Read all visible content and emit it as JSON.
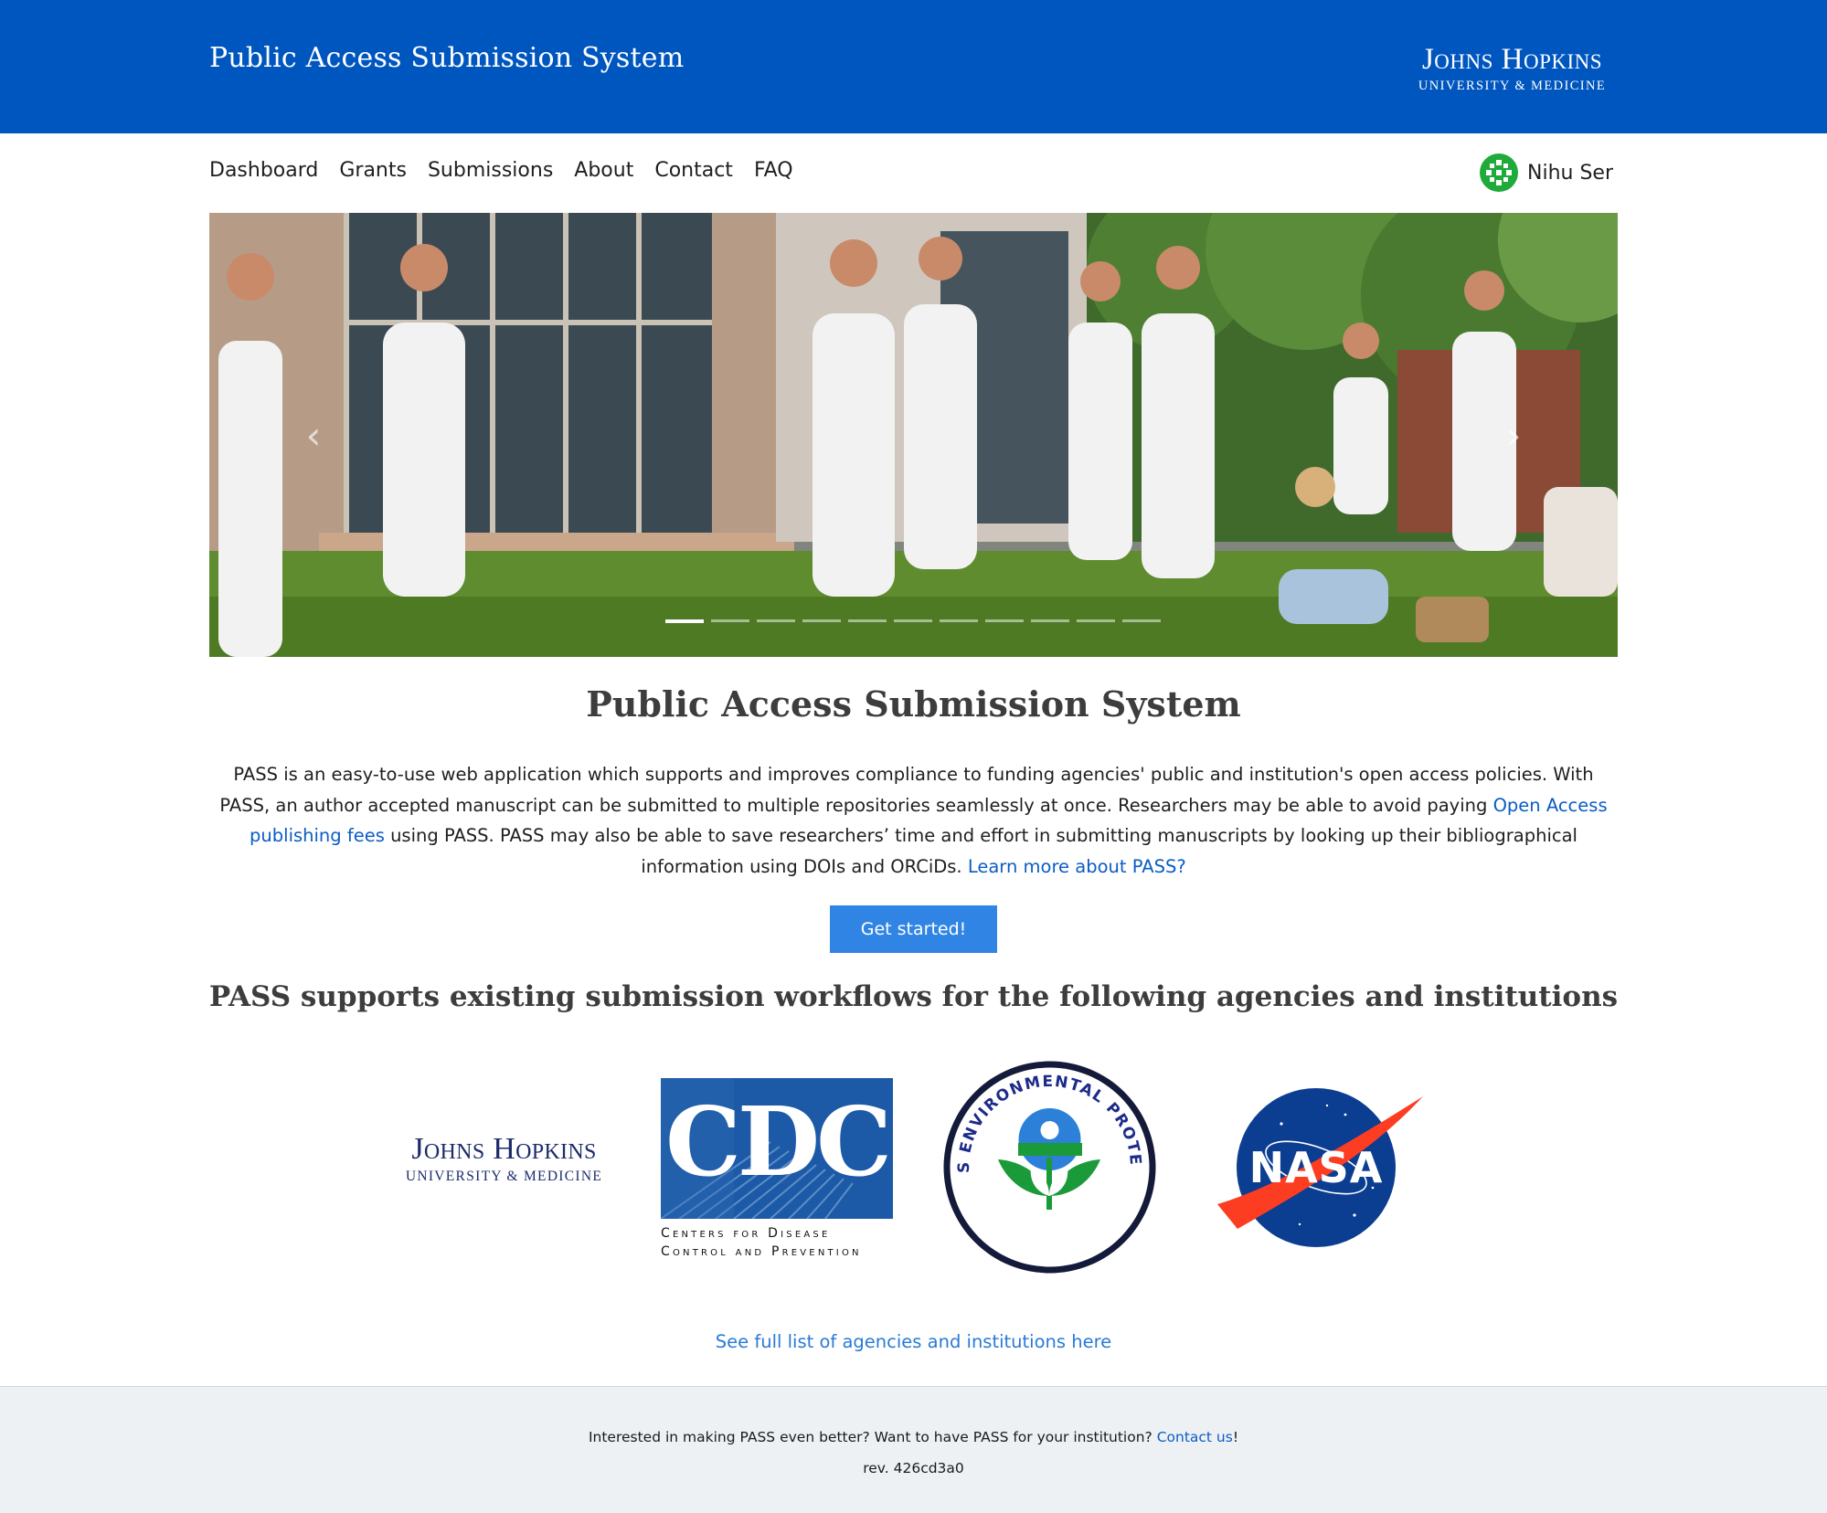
{
  "header": {
    "title": "Public Access Submission System",
    "logo": {
      "name": "Johns Hopkins",
      "subtitle": "UNIVERSITY & MEDICINE"
    }
  },
  "nav": {
    "items": [
      {
        "label": "Dashboard"
      },
      {
        "label": "Grants"
      },
      {
        "label": "Submissions"
      },
      {
        "label": "About"
      },
      {
        "label": "Contact"
      },
      {
        "label": "FAQ"
      }
    ],
    "user": {
      "name": "Nihu Ser",
      "avatar_icon": "user-avatar-icon"
    }
  },
  "carousel": {
    "image_icon": "carousel-photo",
    "prev_icon": "chevron-left-icon",
    "next_icon": "chevron-right-icon",
    "prev_glyph": "‹",
    "next_glyph": "›",
    "slide_count": 11,
    "active_index": 0
  },
  "intro": {
    "title": "Public Access Submission System",
    "text_1": "PASS is an easy-to-use web application which supports and improves compliance to funding agencies' public and institution's open access policies. With PASS, an author accepted manuscript can be submitted to multiple repositories seamlessly at once. Researchers may be able to avoid paying ",
    "link_fees": "Open Access publishing fees",
    "text_2": " using PASS. PASS may also be able to save researchers’ time and effort in submitting manuscripts by looking up their bibliographical information using DOIs and ORCiDs. ",
    "link_learn": "Learn more about PASS?",
    "cta": "Get started!"
  },
  "agencies": {
    "title": "PASS supports existing submission workflows for the following agencies and institutions",
    "jh": {
      "name": "Johns Hopkins",
      "subtitle": "UNIVERSITY & MEDICINE"
    },
    "cdc": {
      "letters": "CDC",
      "caption_1": "Centers for Disease",
      "caption_2": "Control and Prevention"
    },
    "epa": {
      "ring_text": "UNITED STATES ENVIRONMENTAL PROTECTION AGENCY"
    },
    "nasa": {
      "text": "NASA"
    },
    "full_list": "See full list of agencies and institutions here"
  },
  "footer": {
    "text": "Interested in making PASS even better? Want to have PASS for your institution? ",
    "link": "Contact us",
    "suffix": "!",
    "rev": "rev. 426cd3a0"
  },
  "colors": {
    "header_bg": "#0056bf",
    "link": "#0b5cc4",
    "button": "#3085e4",
    "footer_bg": "#eef1f4"
  }
}
